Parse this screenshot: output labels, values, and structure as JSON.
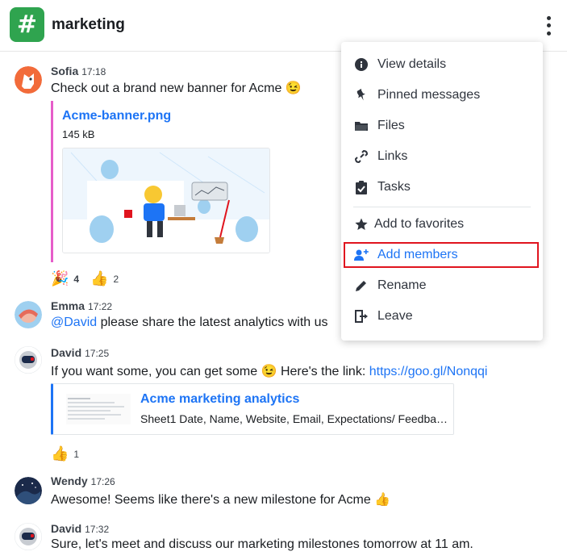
{
  "header": {
    "channel_icon": "#",
    "channel_name": "marketing",
    "kebab_icon": "kebab-menu-icon"
  },
  "messages": [
    {
      "name": "Sofia",
      "time": "17:18",
      "text": "Check out a brand new banner for Acme 😉",
      "attachment": {
        "title": "Acme-banner.png",
        "size": "145 kB"
      },
      "reactions": [
        {
          "emoji": "🎉",
          "count": "4"
        },
        {
          "emoji": "👍",
          "count": "2"
        }
      ]
    },
    {
      "name": "Emma",
      "time": "17:22",
      "mention": "@David",
      "text": " please share the latest analytics with us"
    },
    {
      "name": "David",
      "time": "17:25",
      "text": "If you want some, you can get some 😉 Here's the link: ",
      "link": "https://goo.gl/Nonqqi",
      "card": {
        "title": "Acme marketing analytics",
        "description": "Sheet1 Date, Name, Website, Email, Expectations/ Feedback..."
      },
      "reactions": [
        {
          "emoji": "👍",
          "count": "1"
        }
      ]
    },
    {
      "name": "Wendy",
      "time": "17:26",
      "text": "Awesome! Seems like there's a new milestone for Acme 👍"
    },
    {
      "name": "David",
      "time": "17:32",
      "text": "Sure, let's meet and discuss our marketing milestones tomorrow at 11 am."
    }
  ],
  "menu": {
    "items": [
      {
        "label": "View details",
        "icon": "info-icon"
      },
      {
        "label": "Pinned messages",
        "icon": "pin-icon"
      },
      {
        "label": "Files",
        "icon": "folder-icon"
      },
      {
        "label": "Links",
        "icon": "link-icon"
      },
      {
        "label": "Tasks",
        "icon": "clipboard-check-icon"
      },
      {
        "label": "Add to favorites",
        "icon": "star-icon"
      },
      {
        "label": "Add members",
        "icon": "add-user-icon"
      },
      {
        "label": "Rename",
        "icon": "pencil-icon"
      },
      {
        "label": "Leave",
        "icon": "exit-icon"
      }
    ]
  },
  "colors": {
    "channel_green": "#2fa44f",
    "link_blue": "#1d74f5",
    "highlight_red": "#e0141e",
    "attachment_pink": "#e65dc9"
  }
}
